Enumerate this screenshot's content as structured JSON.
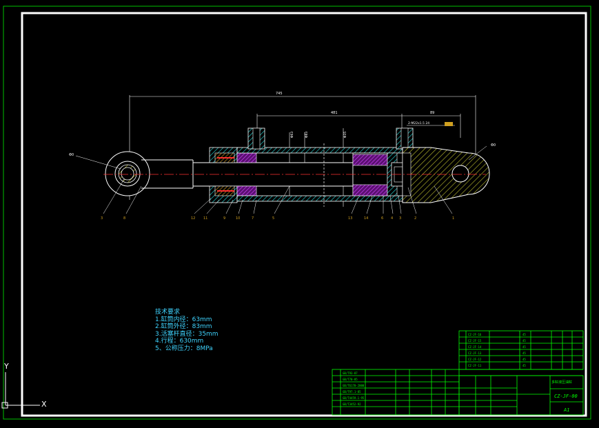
{
  "colors": {
    "background": "#000000",
    "frame": "#ffffff",
    "outer_frame": "#00c000",
    "section_hatch": "#20b0b0",
    "seal_hatch": "#c040ff",
    "bracket_hatch": "#c8c830",
    "centerline": "#ff3030",
    "dimension": "#ffffff",
    "title_block": "#00ff00",
    "notes_text": "#3fd4ff"
  },
  "drawing": {
    "dimensions": {
      "overall_length": "745",
      "stroke_span": "481",
      "right_span": "89",
      "port_callout": "2-M22x1.5 24",
      "left_eye": "Φ0",
      "right_eye": "Φ0",
      "bore_dia": "Φ63",
      "od": "Φ83",
      "rod": "Φ35"
    },
    "balloons": [
      "3",
      "8",
      "12",
      "11",
      "9",
      "10",
      "7",
      "5",
      "13",
      "14",
      "6",
      "4",
      "3",
      "2",
      "1"
    ]
  },
  "technical_requirements": {
    "title": "技术要求",
    "items": [
      "1.缸筒内径：63mm",
      "2.缸筒外径：83mm",
      "3.活塞杆直径：35mm",
      "4.行程：630mm",
      "5、公称压力：8MPa"
    ]
  },
  "title_block": {
    "drawing_number": "CZ-JF-00",
    "sheet_size": "A1",
    "part_name": "多缸液压油缸",
    "parts_list": [
      {
        "code": "CZ-JF-16",
        "qty": "45"
      },
      {
        "code": "CZ-JF-15",
        "qty": "45"
      },
      {
        "code": "CZ-JF-14",
        "qty": "45"
      },
      {
        "code": "CZ-JF-13",
        "qty": "45"
      },
      {
        "code": "CZ-JF-12",
        "qty": "45"
      },
      {
        "code": "CZ-JF-11",
        "qty": "45"
      }
    ],
    "standards_list": [
      "GB/T93-87",
      "GB/T70-85",
      "GB/T6170-2000",
      "GB/T97.1-85",
      "GB/T4459.1-95",
      "GB/T3452-92"
    ]
  },
  "ucs": {
    "x_label": "X",
    "y_label": "Y"
  }
}
